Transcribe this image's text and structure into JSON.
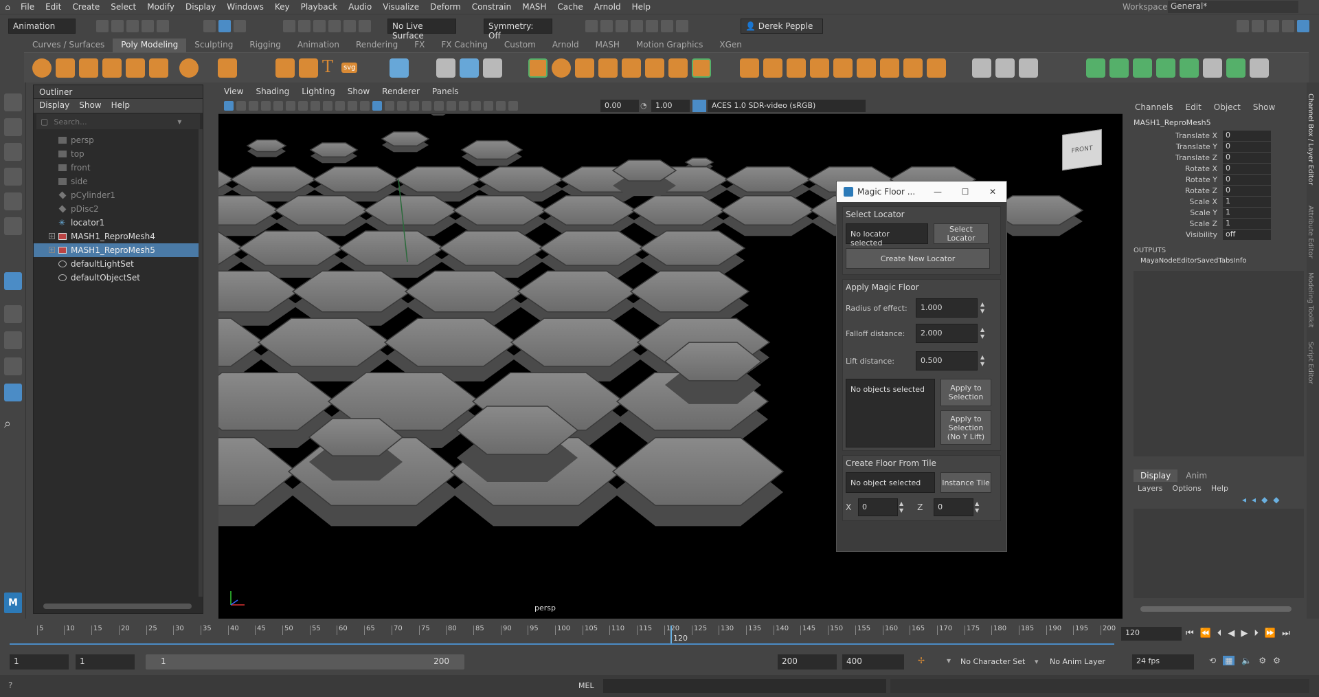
{
  "menubar": {
    "items": [
      "File",
      "Edit",
      "Create",
      "Select",
      "Modify",
      "Display",
      "Windows",
      "Key",
      "Playback",
      "Audio",
      "Visualize",
      "Deform",
      "Constrain",
      "MASH",
      "Cache",
      "Arnold",
      "Help"
    ],
    "workspace_label": "Workspace:",
    "workspace_value": "General*"
  },
  "statusline": {
    "menuset": "Animation",
    "live_surface": "No Live Surface",
    "symmetry": "Symmetry: Off",
    "user": "Derek Pepple"
  },
  "shelf": {
    "tabs": [
      "Curves / Surfaces",
      "Poly Modeling",
      "Sculpting",
      "Rigging",
      "Animation",
      "Rendering",
      "FX",
      "FX Caching",
      "Custom",
      "Arnold",
      "MASH",
      "Motion Graphics",
      "XGen"
    ],
    "active_tab": "Poly Modeling",
    "text_tool": "T",
    "svg_tool": "svg"
  },
  "outliner": {
    "title": "Outliner",
    "menu": [
      "Display",
      "Show",
      "Help"
    ],
    "search_placeholder": "Search...",
    "items": [
      {
        "label": "persp",
        "dim": true
      },
      {
        "label": "top",
        "dim": true
      },
      {
        "label": "front",
        "dim": true
      },
      {
        "label": "side",
        "dim": true
      },
      {
        "label": "pCylinder1",
        "dim": true
      },
      {
        "label": "pDisc2",
        "dim": true
      },
      {
        "label": "locator1",
        "dim": false
      },
      {
        "label": "MASH1_ReproMesh4",
        "dim": false
      },
      {
        "label": "MASH1_ReproMesh5",
        "dim": false
      },
      {
        "label": "defaultLightSet",
        "dim": false
      },
      {
        "label": "defaultObjectSet",
        "dim": false
      }
    ]
  },
  "viewport": {
    "menu": [
      "View",
      "Shading",
      "Lighting",
      "Show",
      "Renderer",
      "Panels"
    ],
    "exposure": "0.00",
    "gamma": "1.00",
    "colorspace": "ACES 1.0 SDR-video (sRGB)",
    "camera_label": "persp",
    "viewcube_label": "FRONT"
  },
  "magic_floor": {
    "title": "Magic Floor ...",
    "select_locator": {
      "label": "Select Locator",
      "field": "No locator selected",
      "select_btn": "Select Locator",
      "create_btn": "Create New Locator"
    },
    "apply": {
      "label": "Apply Magic Floor",
      "radius_label": "Radius of effect:",
      "radius_value": "1.000",
      "falloff_label": "Falloff distance:",
      "falloff_value": "2.000",
      "lift_label": "Lift distance:",
      "lift_value": "0.500",
      "objects_field": "No objects selected",
      "apply_btn": "Apply to Selection",
      "apply_noy_btn": "Apply to Selection (No Y Lift)"
    },
    "create_floor": {
      "label": "Create Floor From Tile",
      "field": "No object selected",
      "instance_btn": "Instance Tile",
      "x_label": "X",
      "x_value": "0",
      "z_label": "Z",
      "z_value": "0"
    }
  },
  "channel_box": {
    "menu": [
      "Channels",
      "Edit",
      "Object",
      "Show"
    ],
    "object": "MASH1_ReproMesh5",
    "channels": [
      {
        "name": "Translate X",
        "value": "0"
      },
      {
        "name": "Translate Y",
        "value": "0"
      },
      {
        "name": "Translate Z",
        "value": "0"
      },
      {
        "name": "Rotate X",
        "value": "0"
      },
      {
        "name": "Rotate Y",
        "value": "0"
      },
      {
        "name": "Rotate Z",
        "value": "0"
      },
      {
        "name": "Scale X",
        "value": "1"
      },
      {
        "name": "Scale Y",
        "value": "1"
      },
      {
        "name": "Scale Z",
        "value": "1"
      },
      {
        "name": "Visibility",
        "value": "off"
      }
    ],
    "outputs_label": "OUTPUTS",
    "outputs_item": "MayaNodeEditorSavedTabsInfo",
    "layer_tabs": [
      "Display",
      "Anim"
    ],
    "layer_menu": [
      "Layers",
      "Options",
      "Help"
    ],
    "side_tabs": [
      "Channel Box / Layer Editor",
      "Attribute Editor",
      "Modeling Toolkit",
      "Script Editor"
    ]
  },
  "timeline": {
    "ticks": [
      "5",
      "10",
      "15",
      "20",
      "25",
      "30",
      "35",
      "40",
      "45",
      "50",
      "55",
      "60",
      "65",
      "70",
      "75",
      "80",
      "85",
      "90",
      "95",
      "100",
      "105",
      "110",
      "115",
      "120",
      "125",
      "130",
      "135",
      "140",
      "145",
      "150",
      "155",
      "160",
      "165",
      "170",
      "175",
      "180",
      "185",
      "190",
      "195",
      "200"
    ],
    "current_frame_marker": "120",
    "current_frame_field": "120"
  },
  "range": {
    "start": "1",
    "playback_start": "1",
    "range_start": "1",
    "range_end": "200",
    "playback_end": "200",
    "end": "400",
    "character_set": "No Character Set",
    "anim_layer": "No Anim Layer",
    "fps": "24 fps"
  },
  "cmdline": {
    "lang": "MEL"
  },
  "colors": {
    "accent": "#4a7aa6",
    "shelf_orange": "#d98a35",
    "shelf_green": "#55b06a"
  }
}
